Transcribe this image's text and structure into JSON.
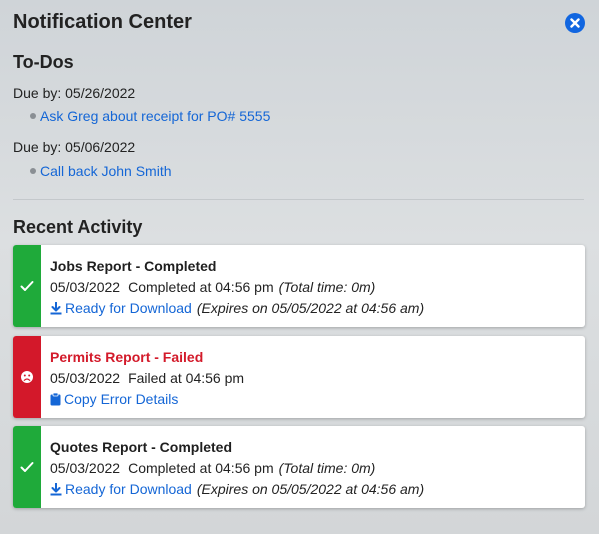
{
  "header": {
    "title": "Notification Center"
  },
  "colors": {
    "success": "#1faa3a",
    "failure": "#d3182a",
    "link": "#1466d6",
    "close": "#1166e0"
  },
  "todos": {
    "heading": "To-Dos",
    "groups": [
      {
        "due": "Due by: 05/26/2022",
        "items": [
          "Ask Greg about receipt for PO# 5555"
        ]
      },
      {
        "due": "Due by: 05/06/2022",
        "items": [
          "Call back John Smith"
        ]
      }
    ]
  },
  "recent": {
    "heading": "Recent Activity",
    "cards": [
      {
        "status": "success",
        "icon": "check-icon",
        "title": "Jobs Report - Completed",
        "date": "05/03/2022",
        "status_text": "Completed at 04:56 pm",
        "extra": "(Total time: 0m)",
        "action": "Ready for Download",
        "action_icon": "download-icon",
        "note": "(Expires on 05/05/2022 at 04:56 am)"
      },
      {
        "status": "failure",
        "icon": "frown-icon",
        "title": "Permits Report - Failed",
        "date": "05/03/2022",
        "status_text": "Failed at 04:56 pm",
        "extra": "",
        "action": "Copy Error Details",
        "action_icon": "clipboard-icon",
        "note": ""
      },
      {
        "status": "success",
        "icon": "check-icon",
        "title": "Quotes Report - Completed",
        "date": "05/03/2022",
        "status_text": "Completed at 04:56 pm",
        "extra": "(Total time: 0m)",
        "action": "Ready for Download",
        "action_icon": "download-icon",
        "note": "(Expires on 05/05/2022 at 04:56 am)"
      }
    ]
  }
}
